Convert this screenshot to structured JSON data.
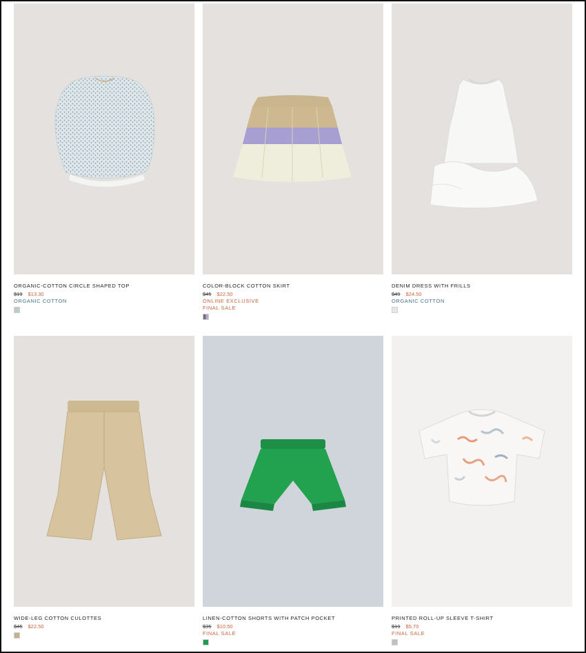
{
  "products": [
    {
      "name": "ORGANIC-COTTON CIRCLE SHAPED TOP",
      "old_price": "$19",
      "new_price": "$13.30",
      "tags": [
        {
          "text": "ORGANIC COTTON",
          "kind": "organic"
        }
      ],
      "swatch": "#b9cccb",
      "image": "circle-top-image"
    },
    {
      "name": "COLOR-BLOCK COTTON SKIRT",
      "old_price": "$45",
      "new_price": "$22.50",
      "tags": [
        {
          "text": "ONLINE EXCLUSIVE",
          "kind": "exclusive"
        },
        {
          "text": "FINAL SALE",
          "kind": "final"
        }
      ],
      "swatch": "#7a6a78",
      "image": "skirt-image"
    },
    {
      "name": "DENIM DRESS WITH FRILLS",
      "old_price": "$49",
      "new_price": "$24.50",
      "tags": [
        {
          "text": "ORGANIC COTTON",
          "kind": "organic"
        }
      ],
      "swatch": "#e6e6e6",
      "image": "dress-image"
    },
    {
      "name": "WIDE-LEG COTTON CULOTTES",
      "old_price": "$45",
      "new_price": "$22.50",
      "tags": [],
      "swatch": "#c6b18d",
      "image": "culottes-image"
    },
    {
      "name": "LINEN-COTTON SHORTS WITH PATCH POCKET",
      "old_price": "$35",
      "new_price": "$10.50",
      "tags": [
        {
          "text": "FINAL SALE",
          "kind": "final"
        }
      ],
      "swatch": "#1f9a57",
      "image": "shorts-image"
    },
    {
      "name": "PRINTED ROLL-UP SLEEVE T-SHIRT",
      "old_price": "$19",
      "new_price": "$5.70",
      "tags": [
        {
          "text": "FINAL SALE",
          "kind": "final"
        }
      ],
      "swatch": "#bfc1c3",
      "image": "tshirt-image"
    }
  ]
}
